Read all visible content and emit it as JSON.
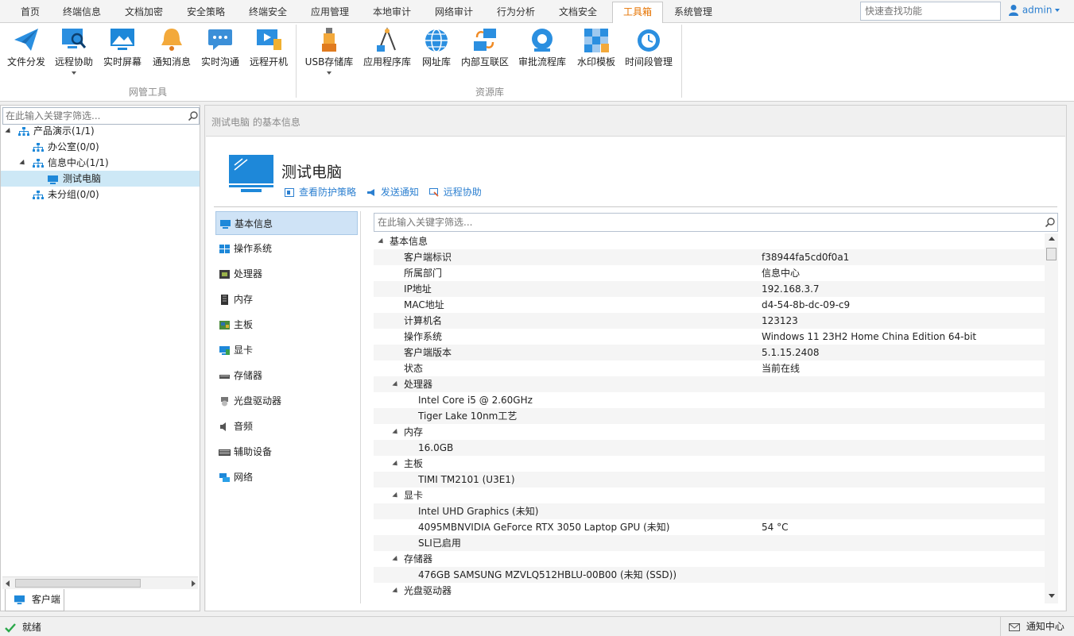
{
  "menu": {
    "tabs": [
      {
        "label": "首页",
        "active": false
      },
      {
        "label": "终端信息",
        "active": false
      },
      {
        "label": "文档加密",
        "active": false
      },
      {
        "label": "安全策略",
        "active": false
      },
      {
        "label": "终端安全",
        "active": false
      },
      {
        "label": "应用管理",
        "active": false
      },
      {
        "label": "本地审计",
        "active": false
      },
      {
        "label": "网络审计",
        "active": false
      },
      {
        "label": "行为分析",
        "active": false
      },
      {
        "label": "文档安全",
        "active": false
      },
      {
        "label": "工具箱",
        "active": true
      },
      {
        "label": "系统管理",
        "active": false
      }
    ],
    "quick_search_placeholder": "快速查找功能",
    "user": "admin"
  },
  "ribbon": {
    "groups": [
      {
        "label": "网管工具",
        "items": [
          {
            "label": "文件分发",
            "icon": "paper-plane-icon",
            "dropdown": false
          },
          {
            "label": "远程协助",
            "icon": "remote-assist-icon",
            "dropdown": true
          },
          {
            "label": "实时屏幕",
            "icon": "live-screen-icon",
            "dropdown": false
          },
          {
            "label": "通知消息",
            "icon": "bell-icon",
            "dropdown": false
          },
          {
            "label": "实时沟通",
            "icon": "chat-icon",
            "dropdown": false
          },
          {
            "label": "远程开机",
            "icon": "remote-power-icon",
            "dropdown": false
          }
        ]
      },
      {
        "label": "资源库",
        "items": [
          {
            "label": "USB存储库",
            "icon": "usb-icon",
            "dropdown": true
          },
          {
            "label": "应用程序库",
            "icon": "app-library-icon",
            "dropdown": false
          },
          {
            "label": "网址库",
            "icon": "globe-icon",
            "dropdown": false
          },
          {
            "label": "内部互联区",
            "icon": "intranet-icon",
            "dropdown": false
          },
          {
            "label": "审批流程库",
            "icon": "approval-gear-icon",
            "dropdown": false
          },
          {
            "label": "水印模板",
            "icon": "watermark-icon",
            "dropdown": false
          },
          {
            "label": "时间段管理",
            "icon": "clock-gear-icon",
            "dropdown": false
          }
        ]
      }
    ]
  },
  "tree": {
    "search_placeholder": "在此输入关键字筛选...",
    "nodes": [
      {
        "label": "产品演示(1/1)",
        "level": 0,
        "expanded": true,
        "type": "org"
      },
      {
        "label": "办公室(0/0)",
        "level": 1,
        "expanded": false,
        "type": "org"
      },
      {
        "label": "信息中心(1/1)",
        "level": 1,
        "expanded": true,
        "type": "org"
      },
      {
        "label": "测试电脑",
        "level": 2,
        "expanded": false,
        "type": "computer",
        "selected": true
      },
      {
        "label": "未分组(0/0)",
        "level": 1,
        "expanded": false,
        "type": "org"
      }
    ],
    "bottom_tab": "客户端"
  },
  "detail": {
    "breadcrumb": "测试电脑 的基本信息",
    "computer_name": "测试电脑",
    "actions": [
      {
        "label": "查看防护策略",
        "icon": "policy-icon"
      },
      {
        "label": "发送通知",
        "icon": "megaphone-icon"
      },
      {
        "label": "远程协助",
        "icon": "remote-icon"
      }
    ],
    "categories": [
      {
        "label": "基本信息",
        "icon": "monitor-icon",
        "active": true
      },
      {
        "label": "操作系统",
        "icon": "windows-icon",
        "active": false
      },
      {
        "label": "处理器",
        "icon": "cpu-icon",
        "active": false
      },
      {
        "label": "内存",
        "icon": "memory-icon",
        "active": false
      },
      {
        "label": "主板",
        "icon": "motherboard-icon",
        "active": false
      },
      {
        "label": "显卡",
        "icon": "gpu-icon",
        "active": false
      },
      {
        "label": "存储器",
        "icon": "disk-icon",
        "active": false
      },
      {
        "label": "光盘驱动器",
        "icon": "cdrom-icon",
        "active": false
      },
      {
        "label": "音频",
        "icon": "speaker-icon",
        "active": false
      },
      {
        "label": "辅助设备",
        "icon": "keyboard-icon",
        "active": false
      },
      {
        "label": "网络",
        "icon": "network-icon",
        "active": false
      }
    ],
    "grid_search_placeholder": "在此输入关键字筛选...",
    "rows": [
      {
        "indent": 0,
        "toggle": true,
        "name": "基本信息",
        "value": ""
      },
      {
        "indent": 1,
        "toggle": false,
        "name": "客户端标识",
        "value": "f38944fa5cd0f0a1"
      },
      {
        "indent": 1,
        "toggle": false,
        "name": "所属部门",
        "value": "信息中心"
      },
      {
        "indent": 1,
        "toggle": false,
        "name": "IP地址",
        "value": "192.168.3.7"
      },
      {
        "indent": 1,
        "toggle": false,
        "name": "MAC地址",
        "value": "d4-54-8b-dc-09-c9"
      },
      {
        "indent": 1,
        "toggle": false,
        "name": "计算机名",
        "value": "123123"
      },
      {
        "indent": 1,
        "toggle": false,
        "name": "操作系统",
        "value": "Windows 11 23H2 Home China Edition 64-bit"
      },
      {
        "indent": 1,
        "toggle": false,
        "name": "客户端版本",
        "value": "5.1.15.2408"
      },
      {
        "indent": 1,
        "toggle": false,
        "name": "状态",
        "value": "当前在线"
      },
      {
        "indent": 1,
        "toggle": true,
        "name": "处理器",
        "value": ""
      },
      {
        "indent": 2,
        "toggle": false,
        "name": "Intel Core i5 @ 2.60GHz",
        "value": ""
      },
      {
        "indent": 2,
        "toggle": false,
        "name": "Tiger Lake 10nm工艺",
        "value": ""
      },
      {
        "indent": 1,
        "toggle": true,
        "name": "内存",
        "value": ""
      },
      {
        "indent": 2,
        "toggle": false,
        "name": "16.0GB",
        "value": ""
      },
      {
        "indent": 1,
        "toggle": true,
        "name": "主板",
        "value": ""
      },
      {
        "indent": 2,
        "toggle": false,
        "name": "TIMI TM2101 (U3E1)",
        "value": ""
      },
      {
        "indent": 1,
        "toggle": true,
        "name": "显卡",
        "value": ""
      },
      {
        "indent": 2,
        "toggle": false,
        "name": "Intel UHD Graphics (未知)",
        "value": ""
      },
      {
        "indent": 2,
        "toggle": false,
        "name": "4095MBNVIDIA GeForce RTX 3050 Laptop GPU (未知)",
        "value": "54 °C"
      },
      {
        "indent": 2,
        "toggle": false,
        "name": "SLI已启用",
        "value": ""
      },
      {
        "indent": 1,
        "toggle": true,
        "name": "存储器",
        "value": ""
      },
      {
        "indent": 2,
        "toggle": false,
        "name": "476GB SAMSUNG MZVLQ512HBLU-00B00 (未知 (SSD))",
        "value": ""
      },
      {
        "indent": 1,
        "toggle": true,
        "name": "光盘驱动器",
        "value": ""
      }
    ]
  },
  "status": {
    "left": "就绪",
    "right": "通知中心"
  },
  "colors": {
    "accent": "#2b7fd0",
    "active_tab": "#e67300",
    "icon_blue": "#1e88d9"
  }
}
